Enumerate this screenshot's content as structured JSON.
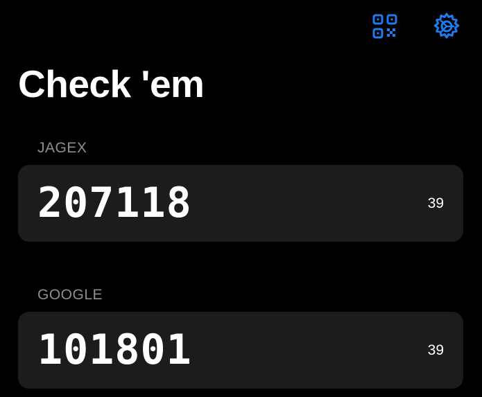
{
  "toolbar": {
    "qr_icon": "qr-code-icon",
    "settings_icon": "gear-icon",
    "accent_color": "#1e7cf0"
  },
  "page": {
    "title": "Check 'em"
  },
  "accounts": [
    {
      "issuer": "JAGEX",
      "code": "207118",
      "seconds_remaining": "39"
    },
    {
      "issuer": "GOOGLE",
      "code": "101801",
      "seconds_remaining": "39"
    }
  ],
  "colors": {
    "background": "#000000",
    "card": "#1c1c1e",
    "label": "#8e8e93",
    "text": "#ffffff"
  }
}
